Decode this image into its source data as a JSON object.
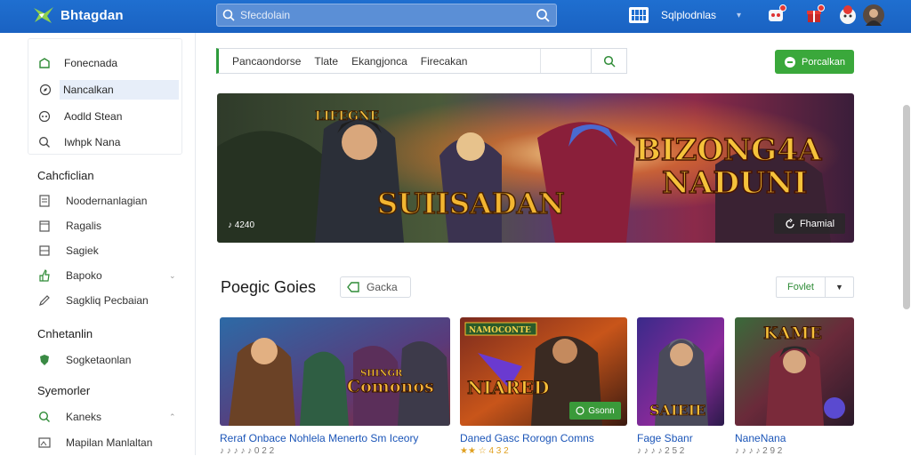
{
  "app": {
    "name": "Bhtagdan"
  },
  "search": {
    "placeholder": "Sfecdolain"
  },
  "topnav": {
    "label": "Sqlplodnlas"
  },
  "sidebar": {
    "items": [
      {
        "label": "Fonecnada",
        "icon": "leaf-icon"
      },
      {
        "label": "Nancalkan",
        "icon": "compass-icon",
        "active": true
      },
      {
        "label": "Aodld Stean",
        "icon": "gamepad-icon"
      },
      {
        "label": "Iwhpk Nana",
        "icon": "search-icon"
      }
    ],
    "sections": [
      {
        "title": "Cahcficlian",
        "items": [
          {
            "label": "Noodernanlagian",
            "icon": "document-icon"
          },
          {
            "label": "Ragalis",
            "icon": "calendar-icon"
          },
          {
            "label": "Sagiek",
            "icon": "grid-icon"
          },
          {
            "label": "Bapoko",
            "icon": "thumbs-up-icon",
            "caret": "⌄"
          },
          {
            "label": "Sagkliq Pecbaian",
            "icon": "pencil-icon"
          }
        ]
      },
      {
        "title": "Cnhetanlin",
        "items": [
          {
            "label": "Sogketaonlan",
            "icon": "shield-icon"
          }
        ]
      },
      {
        "title": "Syemorler",
        "items": [
          {
            "label": "Kaneks",
            "icon": "search-icon",
            "caret": "⌃"
          },
          {
            "label": "Mapilan Manlaltan",
            "icon": "image-icon"
          }
        ]
      }
    ]
  },
  "filters": {
    "items": [
      "Pancaondorse",
      "Tlate",
      "Ekangjonca",
      "Firecakan"
    ]
  },
  "cta": {
    "label": "Porcalkan"
  },
  "hero": {
    "title_left": "SUIISADAN",
    "title_right_1": "BIZONG4A",
    "title_right_2": "NADUNI",
    "banner_top": "LIFEGNE",
    "subtitle": "♪ 4240",
    "button_label": "Fhamial"
  },
  "popular": {
    "title": "Poegic Goies",
    "chip_label": "Gacka",
    "sort_label": "Fovlet"
  },
  "cards": [
    {
      "title": "Reraf Onbace Nohlela Menerto Sm Iceory",
      "meta": "♪ ♪ ♪ ♪ ♪  0 2 2",
      "art": "Comonos",
      "art_top": "SHINGR"
    },
    {
      "title": "Daned Gasc Rorogn Comns",
      "meta": "★★  ☆ 4 3 2",
      "art": "NIARED",
      "art_top": "NAMOCONTE",
      "chip": "Gsonn"
    },
    {
      "title": "Fage Sbanr",
      "meta": "♪ ♪ ♪ ♪  2 5 2",
      "art": "SAIEIE"
    },
    {
      "title": "NaneNana",
      "meta": "♪ ♪ ♪ ♪  2 9 2",
      "art": "KAME"
    }
  ],
  "colors": {
    "topbar": "#1f6fd0",
    "accent_green": "#3aa83b",
    "link_blue": "#1b55b8"
  }
}
